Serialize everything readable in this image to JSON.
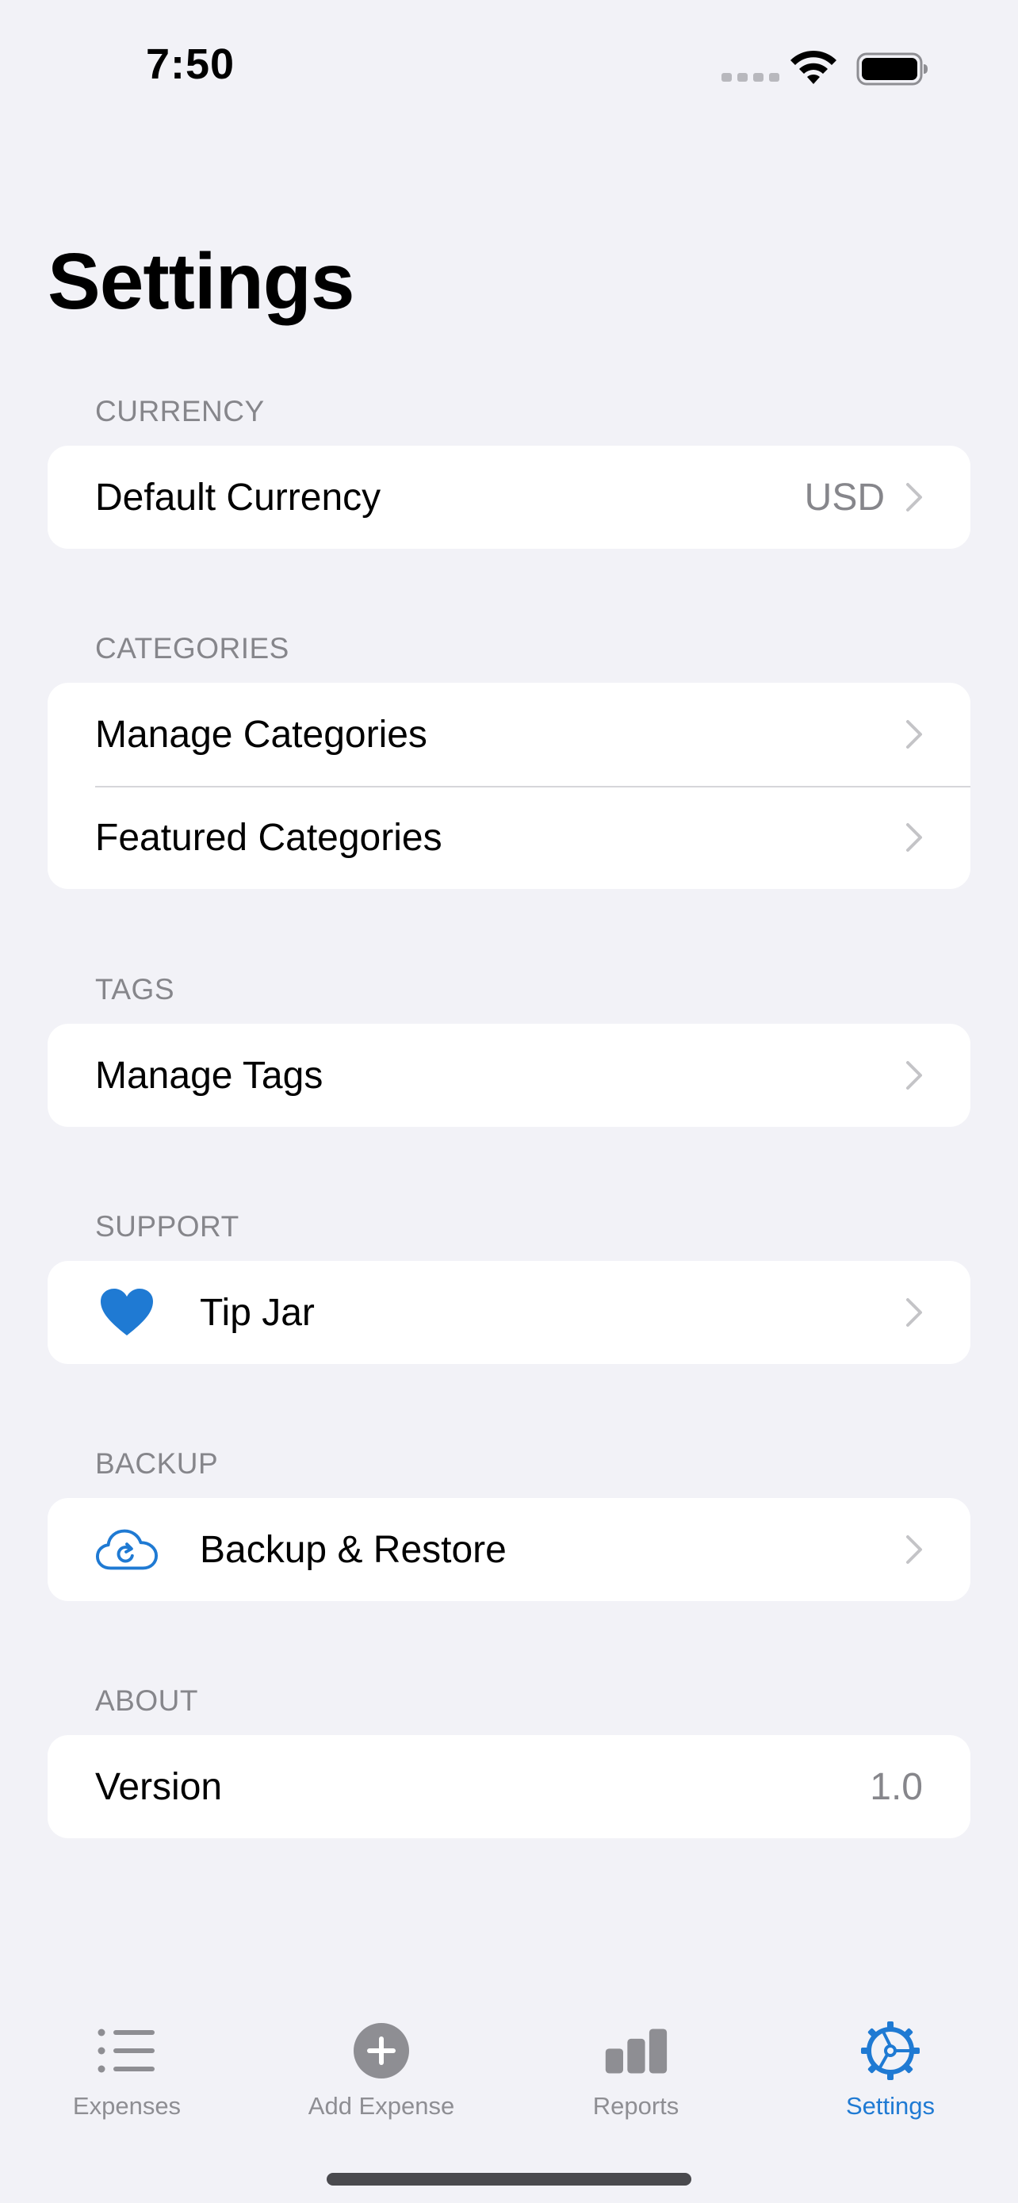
{
  "status_bar": {
    "time": "7:50"
  },
  "page": {
    "title": "Settings"
  },
  "sections": {
    "currency": {
      "header": "CURRENCY",
      "default_currency_label": "Default Currency",
      "default_currency_value": "USD"
    },
    "categories": {
      "header": "CATEGORIES",
      "manage_label": "Manage Categories",
      "featured_label": "Featured Categories"
    },
    "tags": {
      "header": "TAGS",
      "manage_label": "Manage Tags"
    },
    "support": {
      "header": "SUPPORT",
      "tip_jar_label": "Tip Jar",
      "tip_jar_icon": "heart-icon"
    },
    "backup": {
      "header": "BACKUP",
      "backup_label": "Backup & Restore",
      "backup_icon": "cloud-sync-icon"
    },
    "about": {
      "header": "ABOUT",
      "version_label": "Version",
      "version_value": "1.0"
    }
  },
  "tab_bar": {
    "tabs": [
      {
        "label": "Expenses",
        "icon": "list-icon",
        "active": false
      },
      {
        "label": "Add Expense",
        "icon": "plus-circle-icon",
        "active": false
      },
      {
        "label": "Reports",
        "icon": "bar-chart-icon",
        "active": false
      },
      {
        "label": "Settings",
        "icon": "gear-icon",
        "active": true
      }
    ]
  },
  "colors": {
    "background": "#F2F2F7",
    "card": "#FFFFFF",
    "accent": "#1F7AD3",
    "secondary_text": "#86868B",
    "tab_inactive": "#8E8E93"
  }
}
